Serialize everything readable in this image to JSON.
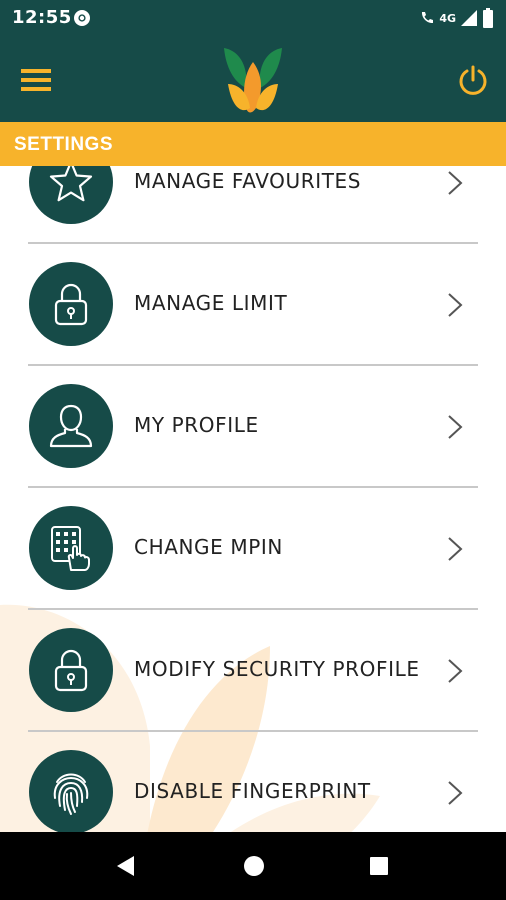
{
  "status_bar": {
    "time": "12:55",
    "network": "4G"
  },
  "app_bar": {
    "menu_icon": "hamburger-menu-icon",
    "logo_icon": "leaf-logo-icon",
    "power_icon": "power-icon"
  },
  "section": {
    "title": "SETTINGS"
  },
  "settings": {
    "items": [
      {
        "label": "MANAGE FAVOURITES",
        "icon": "star-icon"
      },
      {
        "label": "MANAGE LIMIT",
        "icon": "lock-icon"
      },
      {
        "label": "MY PROFILE",
        "icon": "user-icon"
      },
      {
        "label": "CHANGE MPIN",
        "icon": "keypad-icon"
      },
      {
        "label": "MODIFY SECURITY PROFILE",
        "icon": "lock-icon"
      },
      {
        "label": "DISABLE FINGERPRINT",
        "icon": "fingerprint-icon"
      }
    ]
  },
  "nav_bar": {
    "back_icon": "back-icon",
    "home_icon": "home-icon",
    "recents_icon": "recents-icon"
  },
  "colors": {
    "primary": "#164b48",
    "accent": "#f7b32b",
    "logo_green": "#1f8a4c",
    "logo_orange": "#f39a2c"
  }
}
